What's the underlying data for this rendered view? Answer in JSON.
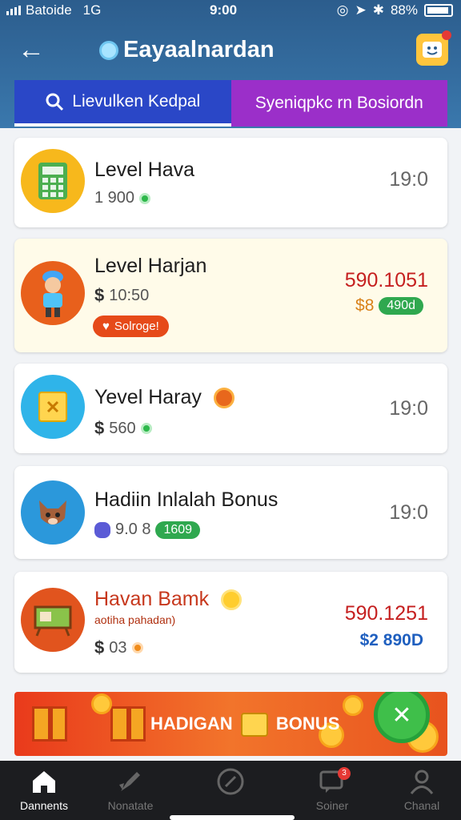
{
  "status": {
    "carrier": "Batoide",
    "network": "1G",
    "time": "9:00",
    "battery": "88%"
  },
  "appbar": {
    "title": "Eayaalnardan"
  },
  "tabs": [
    {
      "label": "Lievulken Kedpal"
    },
    {
      "label": "Syeniqpkc rn Bosiordn"
    }
  ],
  "cards": [
    {
      "name": "Level Hava",
      "sub": "1 900",
      "value": "19:0"
    },
    {
      "name": "Level Harjan",
      "sub": "10:50",
      "value": "590.1051",
      "value_sub_a": "$8",
      "value_sub_pill": "490d",
      "badge": "Solroge!"
    },
    {
      "name": "Yevel Haray",
      "sub": "560",
      "value": "19:0"
    },
    {
      "name": "Hadiin Inlalah Bonus",
      "sub": "9.0 8",
      "sub_pill": "1609",
      "value": "19:0"
    },
    {
      "name": "Havan Bamk",
      "sub2": "aotiha pahadan)",
      "sub": "03",
      "value": "590.1251",
      "value_sub_a": "$2 890D"
    }
  ],
  "banner": {
    "text_a": "HADIGAN",
    "text_b": "BONUS"
  },
  "nav": [
    {
      "label": "Dannents",
      "icon": "home-icon"
    },
    {
      "label": "Nonatate",
      "icon": "rocket-icon"
    },
    {
      "label": "",
      "icon": "compass-icon"
    },
    {
      "label": "Soiner",
      "icon": "chat-icon",
      "badge": "3"
    },
    {
      "label": "Chanal",
      "icon": "user-icon"
    }
  ],
  "colors": {
    "header": "#2c5d8d",
    "tab_active": "#2a47c7",
    "tab_inactive": "#9b2fc9",
    "value_red": "#c51f1f",
    "pill_green": "#2fa84f"
  }
}
